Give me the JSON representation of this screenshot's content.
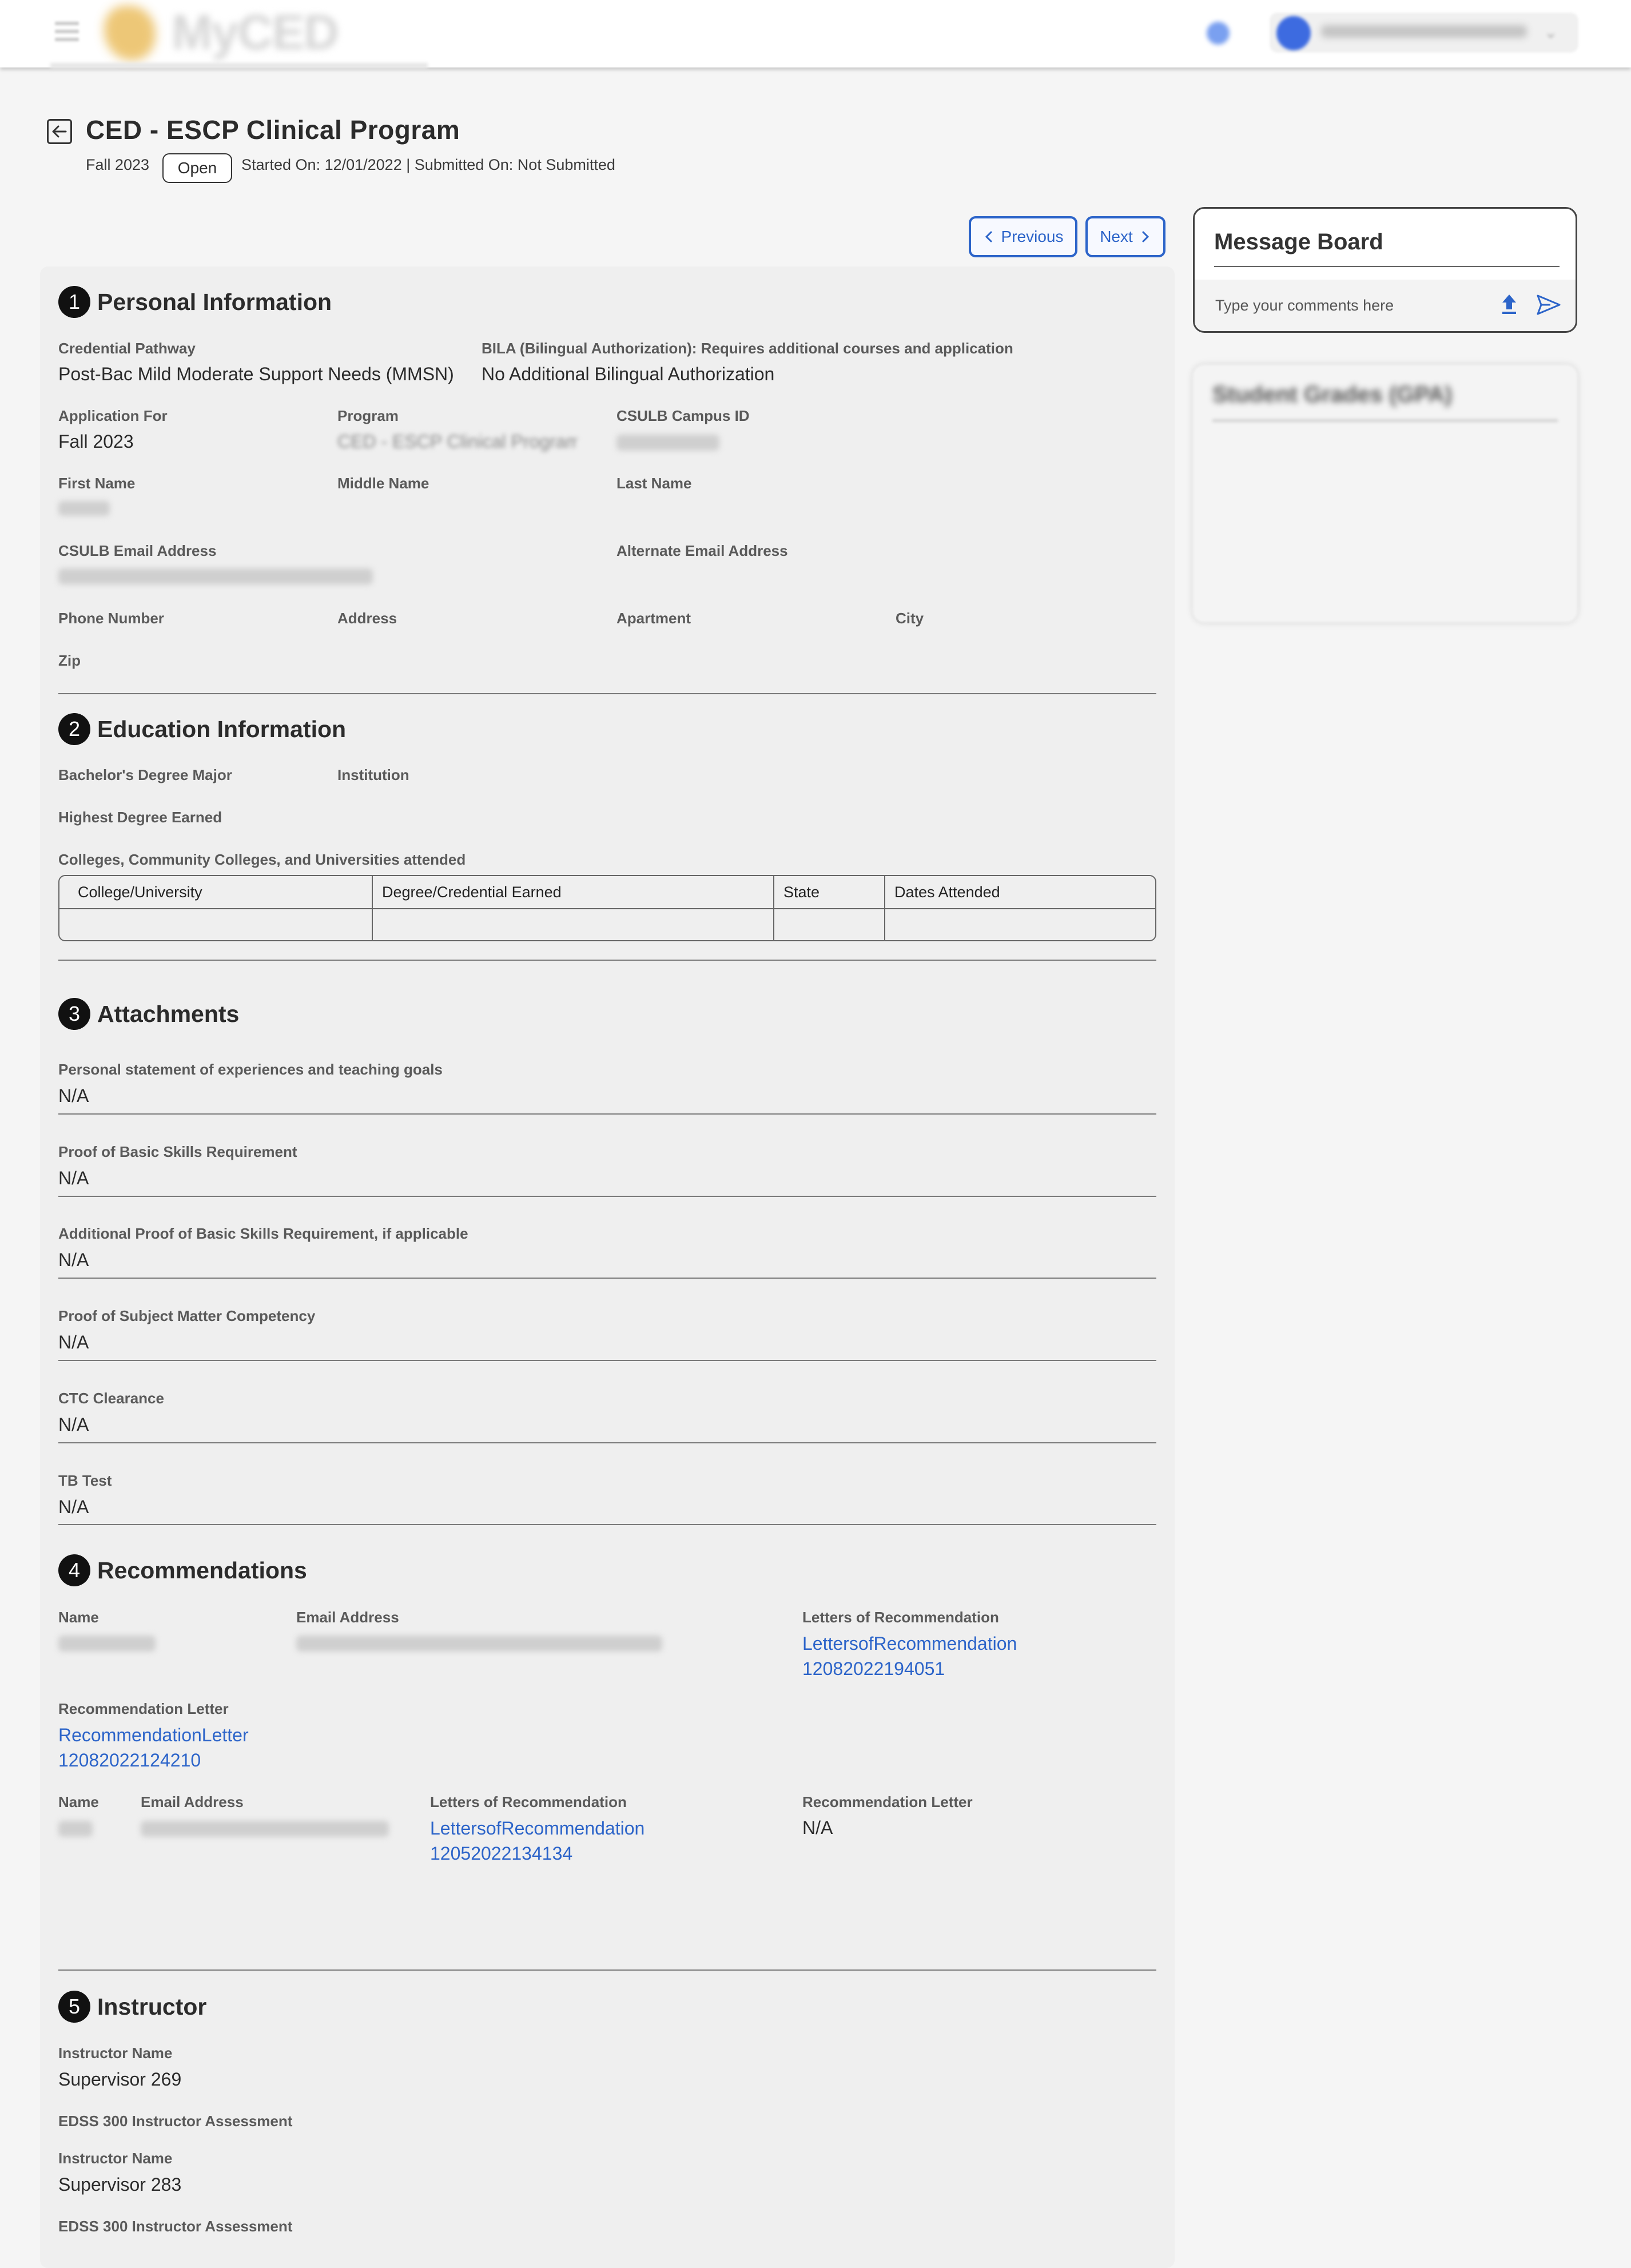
{
  "header": {
    "logo_text": "MyCED"
  },
  "page": {
    "title": "CED - ESCP Clinical Program",
    "term": "Fall 2023",
    "status": "Open",
    "dates_line": "Started On: 12/01/2022 | Submitted On: Not Submitted"
  },
  "nav": {
    "previous_label": "Previous",
    "next_label": "Next"
  },
  "personal": {
    "number": "1",
    "title": "Personal Information",
    "credential_pathway_label": "Credential Pathway",
    "credential_pathway_value": "Post-Bac Mild Moderate Support Needs (MMSN)",
    "bila_label": "BILA (Bilingual Authorization): Requires additional courses and application",
    "bila_value": "No Additional Bilingual Authorization",
    "application_for_label": "Application For",
    "application_for_value": "Fall 2023",
    "program_label": "Program",
    "program_value": "CED - ESCP Clinical Program",
    "campus_id_label": "CSULB Campus ID",
    "first_name_label": "First Name",
    "middle_name_label": "Middle Name",
    "last_name_label": "Last Name",
    "csulb_email_label": "CSULB Email Address",
    "alt_email_label": "Alternate Email Address",
    "phone_label": "Phone Number",
    "address_label": "Address",
    "apartment_label": "Apartment",
    "city_label": "City",
    "zip_label": "Zip"
  },
  "education": {
    "number": "2",
    "title": "Education Information",
    "bachelors_label": "Bachelor's Degree Major",
    "institution_label": "Institution",
    "highest_degree_label": "Highest Degree Earned",
    "colleges_label": "Colleges, Community Colleges, and Universities attended",
    "columns": [
      "College/University",
      "Degree/Credential Earned",
      "State",
      "Dates Attended"
    ]
  },
  "attachments": {
    "number": "3",
    "title": "Attachments",
    "items": [
      {
        "label": "Personal statement of experiences and teaching goals",
        "value": "N/A"
      },
      {
        "label": "Proof of Basic Skills Requirement",
        "value": "N/A"
      },
      {
        "label": "Additional Proof of Basic Skills Requirement, if applicable",
        "value": "N/A"
      },
      {
        "label": "Proof of Subject Matter Competency",
        "value": "N/A"
      },
      {
        "label": "CTC Clearance",
        "value": "N/A"
      },
      {
        "label": "TB Test",
        "value": "N/A"
      }
    ]
  },
  "recommendations": {
    "number": "4",
    "title": "Recommendations",
    "name_label": "Name",
    "email_label": "Email Address",
    "letters_label": "Letters of Recommendation",
    "rec_letter_label": "Recommendation Letter",
    "r1_letters_line1": "LettersofRecommendation",
    "r1_letters_line2": "12082022194051",
    "r1_rec_line1": "RecommendationLetter",
    "r1_rec_line2": "12082022124210",
    "r2_letters_line1": "LettersofRecommendation",
    "r2_letters_line2": "12052022134134",
    "r2_rec_value": "N/A"
  },
  "instructor": {
    "number": "5",
    "title": "Instructor",
    "name_label": "Instructor Name",
    "assessment_label": "EDSS 300 Instructor Assessment",
    "entries": [
      "Supervisor 269",
      "Supervisor 283"
    ]
  },
  "message_board": {
    "title": "Message Board",
    "placeholder": "Type your comments here"
  },
  "grades": {
    "title": "Student Grades (GPA)"
  },
  "colors": {
    "accent": "#2c64c9",
    "panel_bg": "#efefef",
    "page_bg": "#f5f5f5"
  }
}
